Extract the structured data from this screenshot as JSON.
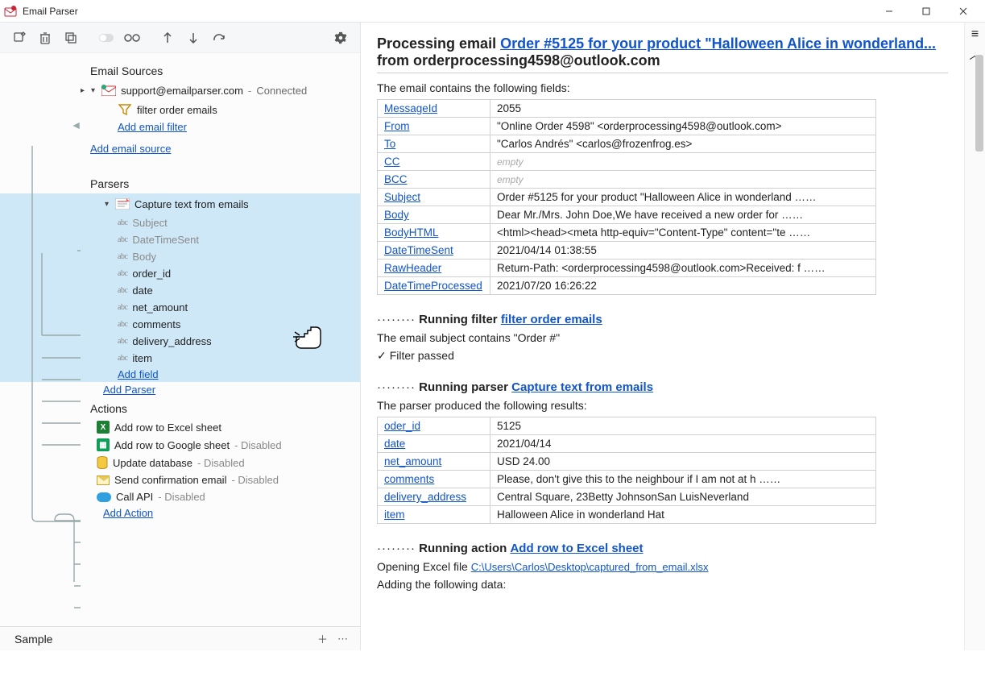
{
  "window": {
    "title": "Email Parser"
  },
  "left": {
    "sections": {
      "sources": {
        "header": "Email Sources",
        "email": "support@emailparser.com",
        "status": "Connected",
        "filter": "filter order emails",
        "add_filter": "Add email filter",
        "add_source": "Add email source"
      },
      "parsers": {
        "header": "Parsers",
        "capture": "Capture text from emails",
        "fields": [
          "Subject",
          "DateTimeSent",
          "Body",
          "order_id",
          "date",
          "net_amount",
          "comments",
          "delivery_address",
          "item"
        ],
        "add_field": "Add field",
        "add_parser": "Add Parser"
      },
      "actions": {
        "header": "Actions",
        "list": [
          {
            "label": "Add row to Excel sheet",
            "disabled": false,
            "icon": "excel"
          },
          {
            "label": "Add row to Google sheet",
            "disabled": true,
            "icon": "gsheet"
          },
          {
            "label": "Update database",
            "disabled": true,
            "icon": "db"
          },
          {
            "label": "Send confirmation email",
            "disabled": true,
            "icon": "envelope"
          },
          {
            "label": "Call API",
            "disabled": true,
            "icon": "cloud"
          }
        ],
        "disabled_suffix": "Disabled",
        "add_action": "Add Action"
      }
    },
    "bottom_tab": "Sample"
  },
  "right": {
    "heading_prefix": "Processing email ",
    "heading_link": "Order #5125 for your product \"Halloween Alice in wonderland...",
    "heading_suffix_from": " from orderprocessing4598@outlook.com",
    "intro": "The email contains the following fields:",
    "fieldrows": [
      {
        "k": "MessageId",
        "v": "2055"
      },
      {
        "k": "From",
        "v": "\"Online Order 4598\" <orderprocessing4598@outlook.com>"
      },
      {
        "k": "To",
        "v": "\"Carlos Andrés\" <carlos@frozenfrog.es>"
      },
      {
        "k": "CC",
        "v": "",
        "empty": true
      },
      {
        "k": "BCC",
        "v": "",
        "empty": true
      },
      {
        "k": "Subject",
        "v": "Order #5125 for your product \"Halloween Alice in wonderland  ……"
      },
      {
        "k": "Body",
        "v": "Dear Mr./Mrs. John Doe,We have received a new order for  ……"
      },
      {
        "k": "BodyHTML",
        "v": "<html><head><meta http-equiv=\"Content-Type\" content=\"te  ……"
      },
      {
        "k": "DateTimeSent",
        "v": "2021/04/14 01:38:55"
      },
      {
        "k": "RawHeader",
        "v": "Return-Path: <orderprocessing4598@outlook.com>Received: f  ……"
      },
      {
        "k": "DateTimeProcessed",
        "v": "2021/07/20 16:26:22"
      }
    ],
    "run_filter": {
      "label": "Running filter",
      "link": "filter order emails",
      "line1": "The email subject contains \"Order #\"",
      "passed": "Filter passed"
    },
    "run_parser": {
      "label": "Running parser",
      "link": "Capture text from emails",
      "line1": "The parser produced the following results:"
    },
    "parserrows": [
      {
        "k": "oder_id",
        "v": "5125"
      },
      {
        "k": "date",
        "v": "2021/04/14"
      },
      {
        "k": "net_amount",
        "v": "USD 24.00"
      },
      {
        "k": "comments",
        "v": "Please, don't give this to the neighbour if I am not at h  ……"
      },
      {
        "k": "delivery_address",
        "v": "Central Square, 23Betty JohnsonSan LuisNeverland"
      },
      {
        "k": "item",
        "v": "Halloween Alice in wonderland Hat"
      }
    ],
    "run_action": {
      "label": "Running action",
      "link": "Add row to Excel sheet",
      "open_prefix": "Opening Excel file ",
      "open_link": "C:\\Users\\Carlos\\Desktop\\captured_from_email.xlsx",
      "adding": "Adding the following data:"
    }
  }
}
